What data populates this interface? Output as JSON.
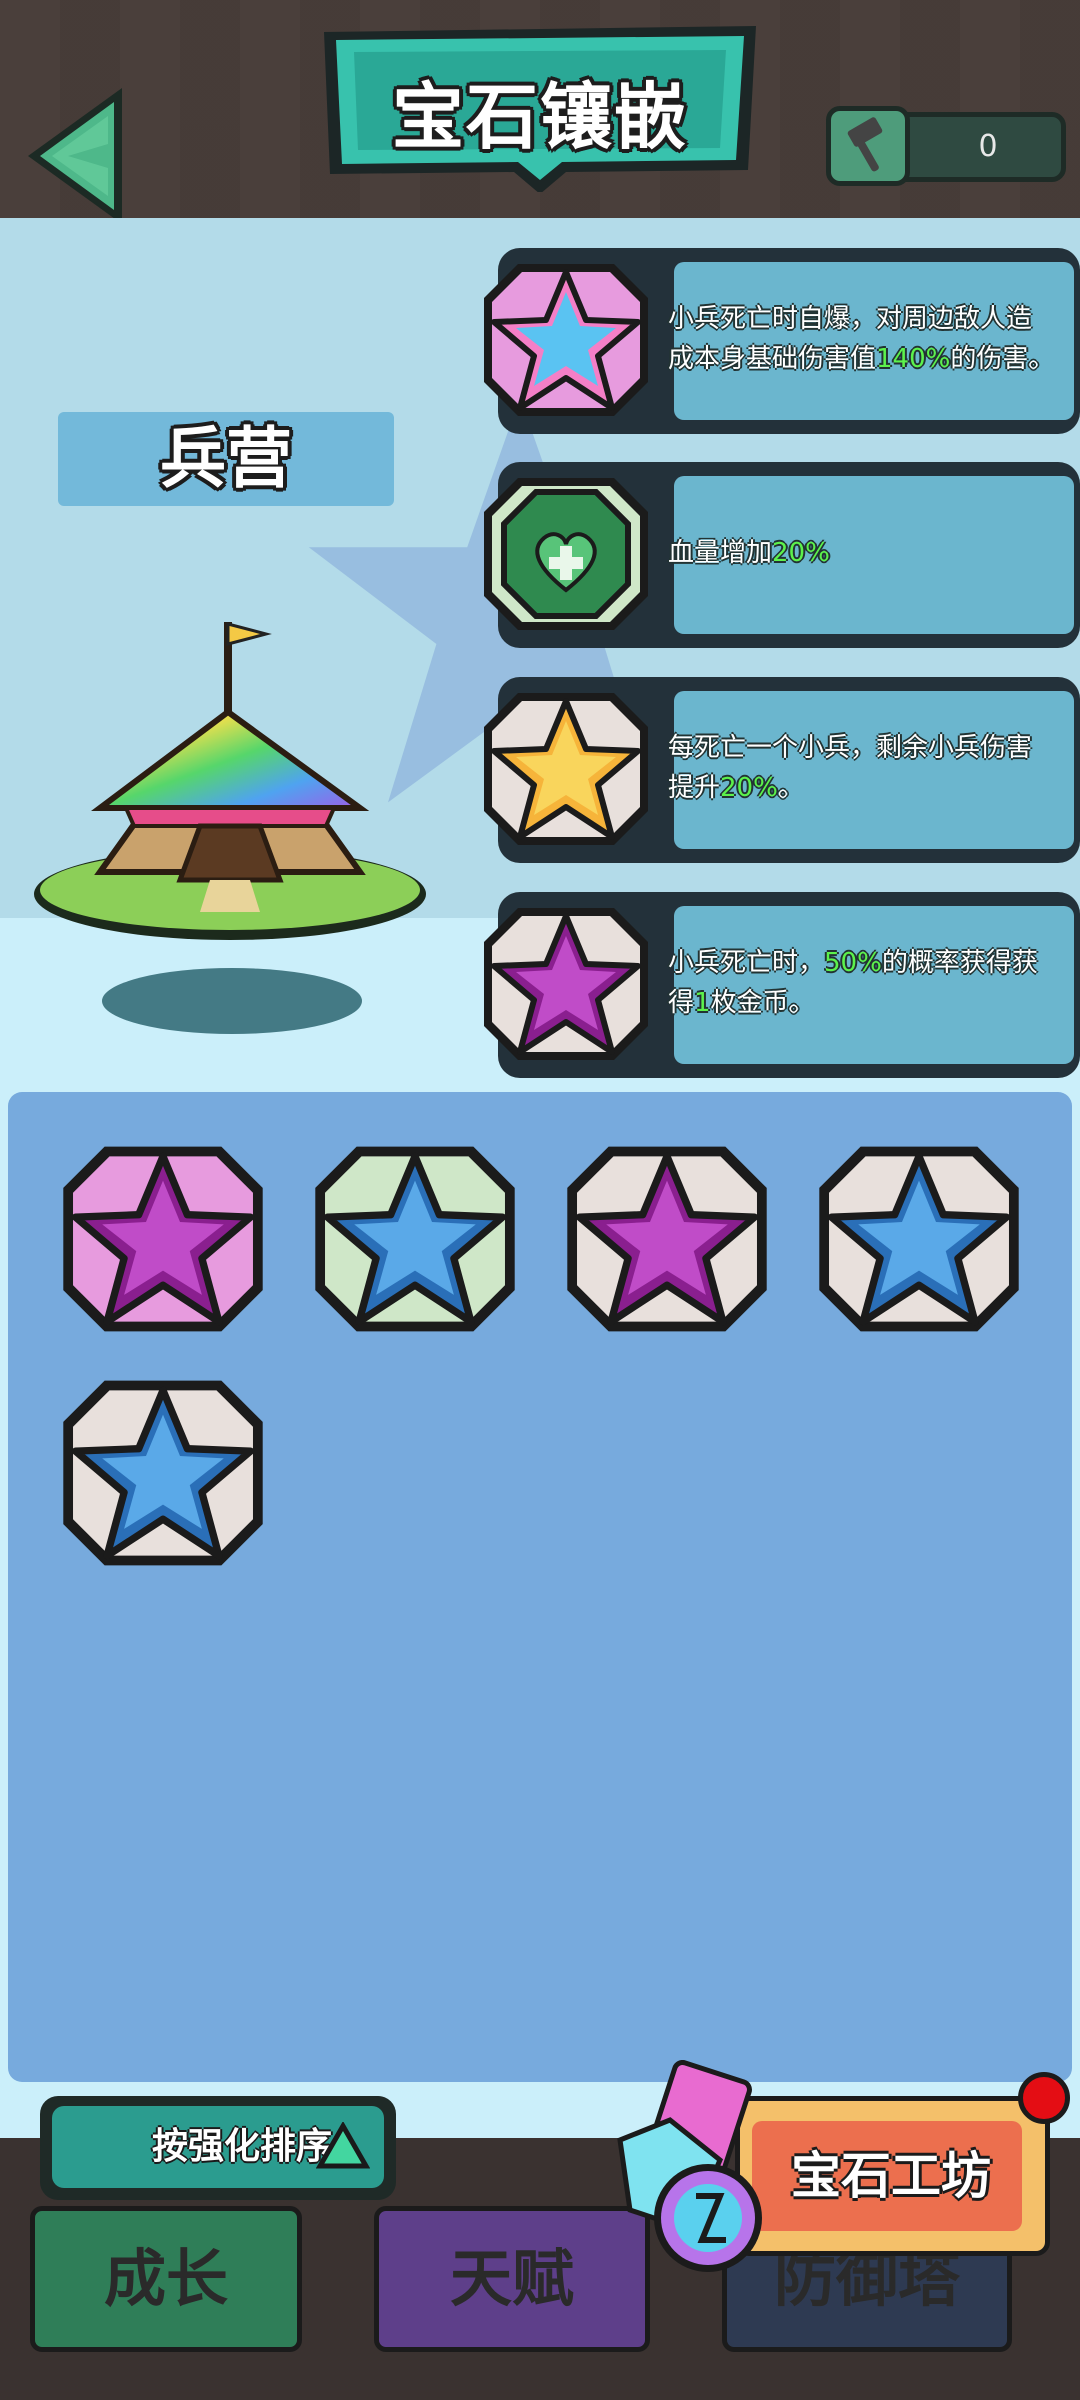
{
  "header": {
    "title": "宝石镶嵌",
    "hammer_count": "0",
    "back_icon": "back-arrow-icon",
    "hammer_icon": "hammer-icon"
  },
  "building": {
    "name": "兵营"
  },
  "effects": [
    {
      "icon": "rainbow-star-skull-gem-icon",
      "parts": [
        [
          "小兵死亡时自爆，对周边敌人造成本身基础伤害值",
          false
        ],
        [
          "140%",
          true
        ],
        [
          "的伤害。",
          false
        ]
      ]
    },
    {
      "icon": "green-heart-plus-gem-icon",
      "parts": [
        [
          "血量增加",
          false
        ],
        [
          "20%",
          true
        ]
      ]
    },
    {
      "icon": "gold-star-sword-gem-icon",
      "parts": [
        [
          "每死亡一个小兵，剩余小兵伤害提升",
          false
        ],
        [
          "20%",
          true
        ],
        [
          "。",
          false
        ]
      ]
    },
    {
      "icon": "purple-star-recycle-gem-icon",
      "parts": [
        [
          "小兵死亡时，",
          false
        ],
        [
          "50%",
          true
        ],
        [
          "的概率获得获得",
          false
        ],
        [
          "1",
          true
        ],
        [
          "枚金币。",
          false
        ]
      ]
    }
  ],
  "inventory": [
    {
      "icon": "purple-star-fang-heart-gem-icon",
      "frame": "pink"
    },
    {
      "icon": "blue-star-swords-gem-icon",
      "frame": "green"
    },
    {
      "icon": "purple-star-recycle-gem-icon",
      "frame": "gray"
    },
    {
      "icon": "blue-star-swords-gem-icon",
      "frame": "gray"
    },
    {
      "icon": "blue-star-swords-gem-icon",
      "frame": "gray"
    }
  ],
  "sort": {
    "label": "按强化排序"
  },
  "tabs": [
    {
      "label": "成长"
    },
    {
      "label": "天赋"
    },
    {
      "label": "防御塔"
    }
  ],
  "workshop": {
    "label": "宝石工坊"
  },
  "colors": {
    "accent_teal": "#2fb8a6",
    "panel_blue": "#6bb6ce",
    "highlight_green": "#5cf24c",
    "notification_red": "#e40d14"
  }
}
